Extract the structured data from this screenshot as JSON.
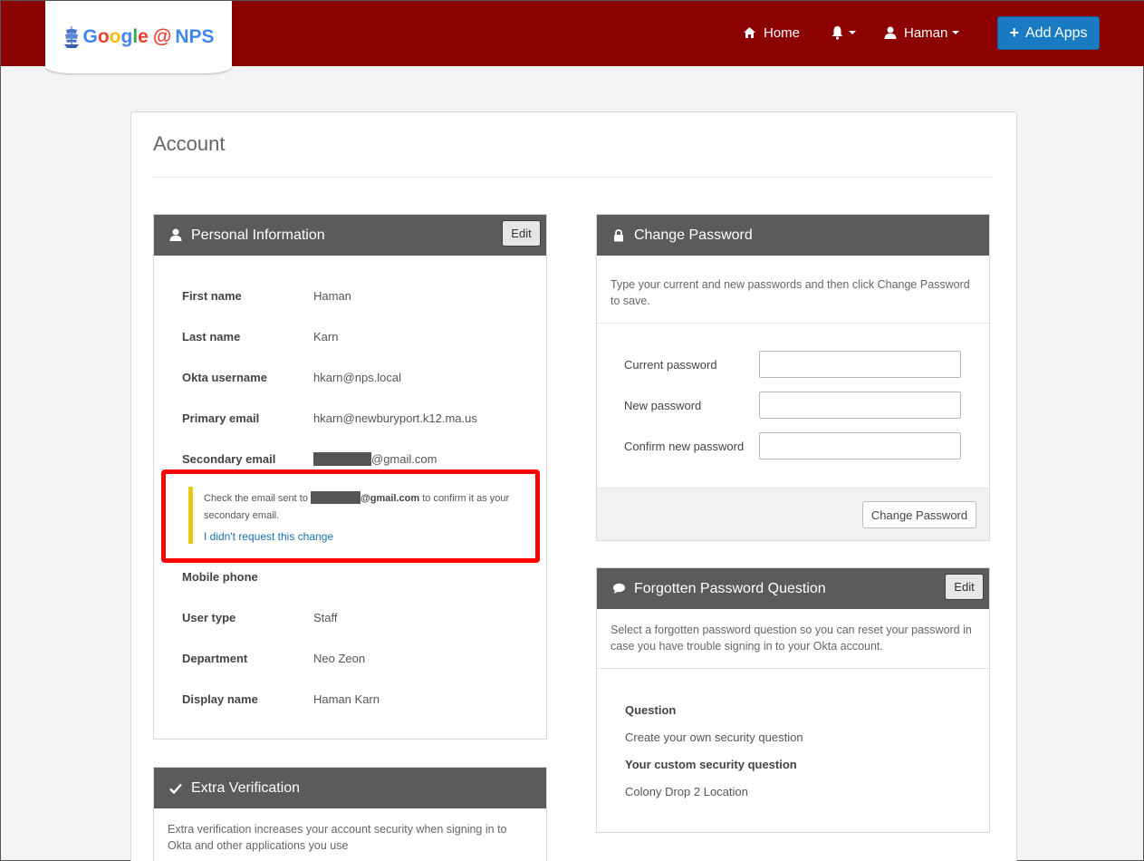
{
  "header": {
    "logo": {
      "g1": "G",
      "g2": "o",
      "g3": "o",
      "g4": "g",
      "g5": "l",
      "g6": "e",
      "at": "@",
      "nps": "NPS"
    },
    "nav": {
      "home": "Home",
      "user": "Haman"
    },
    "add_apps": "Add Apps",
    "colors": {
      "bar": "#8b0000",
      "add_apps": "#1a7bc2"
    }
  },
  "page": {
    "title": "Account"
  },
  "personal": {
    "heading": "Personal Information",
    "edit": "Edit",
    "rows": [
      {
        "label": "First name",
        "value": "Haman"
      },
      {
        "label": "Last name",
        "value": "Karn"
      },
      {
        "label": "Okta username",
        "value": "hkarn@nps.local"
      },
      {
        "label": "Primary email",
        "value": "hkarn@newburyport.k12.ma.us"
      },
      {
        "label": "Secondary email",
        "value": "@gmail.com"
      },
      {
        "label": "Mobile phone",
        "value": ""
      },
      {
        "label": "User type",
        "value": "Staff"
      },
      {
        "label": "Department",
        "value": "Neo Zeon"
      },
      {
        "label": "Display name",
        "value": "Haman Karn"
      }
    ],
    "notice": {
      "pre": "Check the email sent to ",
      "email": "@gmail.com",
      "post": " to confirm it as your secondary email.",
      "link": "I didn't request this change"
    }
  },
  "change_password": {
    "heading": "Change Password",
    "description": "Type your current and new passwords and then click Change Password to save.",
    "fields": [
      {
        "label": "Current password",
        "value": ""
      },
      {
        "label": "New password",
        "value": ""
      },
      {
        "label": "Confirm new password",
        "value": ""
      }
    ],
    "button": "Change Password"
  },
  "forgotten_question": {
    "heading": "Forgotten Password Question",
    "edit": "Edit",
    "description": "Select a forgotten password question so you can reset your password in case you have trouble signing in to your Okta account.",
    "question_label": "Question",
    "question_value": "Create your own security question",
    "custom_label": "Your custom security question",
    "custom_value": "Colony Drop 2 Location"
  },
  "extra_verification": {
    "heading": "Extra Verification",
    "description": "Extra verification increases your account security when signing in to Okta and other applications you use"
  }
}
